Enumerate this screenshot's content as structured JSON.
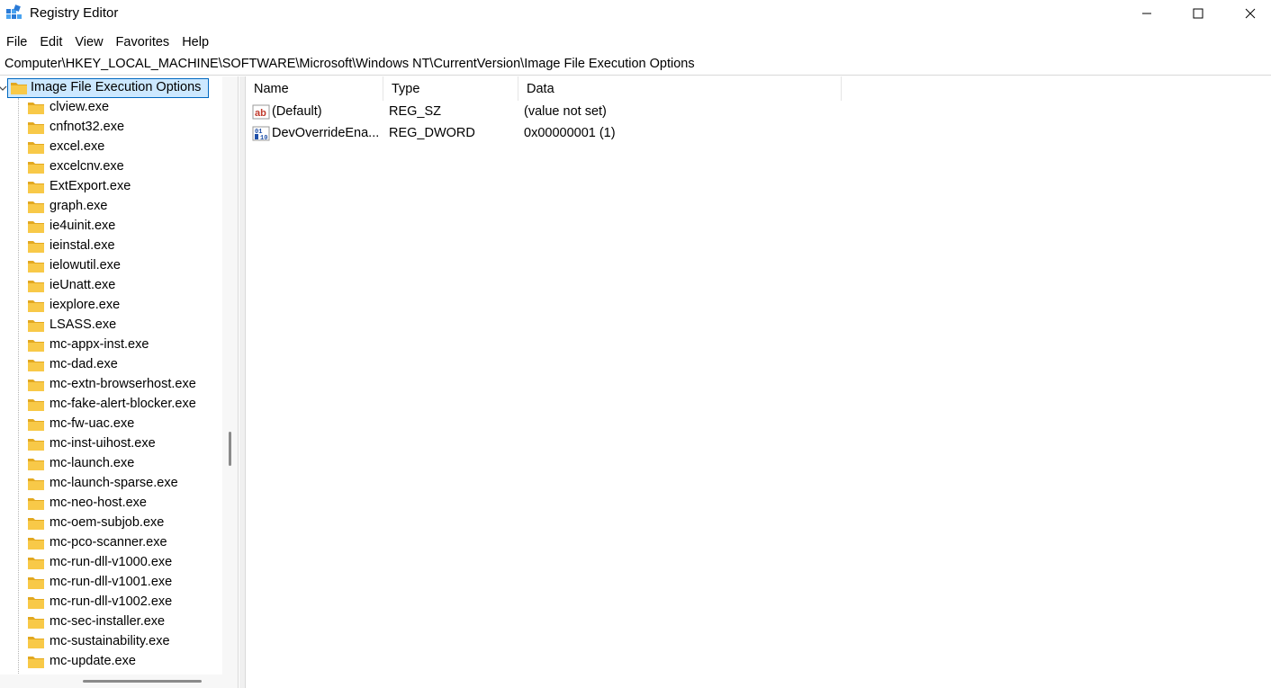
{
  "window": {
    "title": "Registry Editor",
    "icon": "registry-editor-icon",
    "controls": {
      "minimize": "minimize-icon",
      "maximize": "maximize-icon",
      "close": "close-icon"
    }
  },
  "menu": [
    "File",
    "Edit",
    "View",
    "Favorites",
    "Help"
  ],
  "address": "Computer\\HKEY_LOCAL_MACHINE\\SOFTWARE\\Microsoft\\Windows NT\\CurrentVersion\\Image File Execution Options",
  "tree": {
    "selected": "Image File Execution Options",
    "children": [
      "clview.exe",
      "cnfnot32.exe",
      "excel.exe",
      "excelcnv.exe",
      "ExtExport.exe",
      "graph.exe",
      "ie4uinit.exe",
      "ieinstal.exe",
      "ielowutil.exe",
      "ieUnatt.exe",
      "iexplore.exe",
      "LSASS.exe",
      "mc-appx-inst.exe",
      "mc-dad.exe",
      "mc-extn-browserhost.exe",
      "mc-fake-alert-blocker.exe",
      "mc-fw-uac.exe",
      "mc-inst-uihost.exe",
      "mc-launch.exe",
      "mc-launch-sparse.exe",
      "mc-neo-host.exe",
      "mc-oem-subjob.exe",
      "mc-pco-scanner.exe",
      "mc-run-dll-v1000.exe",
      "mc-run-dll-v1001.exe",
      "mc-run-dll-v1002.exe",
      "mc-sec-installer.exe",
      "mc-sustainability.exe",
      "mc-update.exe"
    ]
  },
  "values": {
    "columns": {
      "name": "Name",
      "type": "Type",
      "data": "Data"
    },
    "rows": [
      {
        "icon": "string-value-icon",
        "name": "(Default)",
        "type": "REG_SZ",
        "data": "(value not set)"
      },
      {
        "icon": "dword-value-icon",
        "name": "DevOverrideEna...",
        "type": "REG_DWORD",
        "data": "0x00000001 (1)"
      }
    ]
  },
  "colors": {
    "selection_bg": "#cce8ff",
    "selection_border": "#0067c0",
    "folder": "#f8c948",
    "folder_dark": "#e2a820"
  }
}
